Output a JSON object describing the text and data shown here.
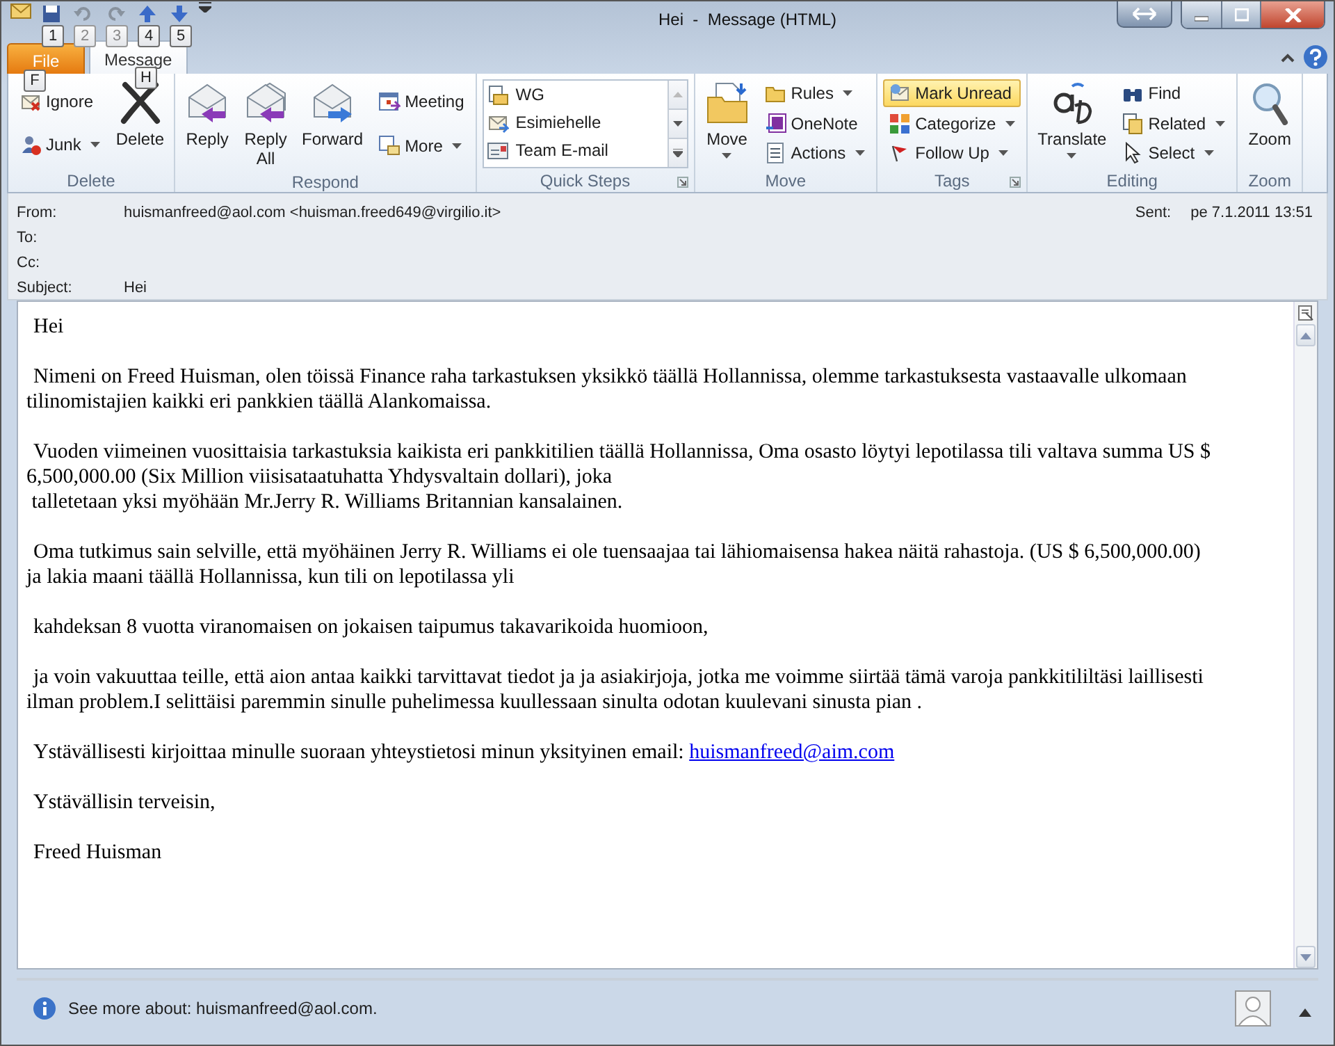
{
  "window": {
    "title": "Hei  -  Message (HTML)"
  },
  "quick_access": [
    {
      "key_tip": "1",
      "disabled": false
    },
    {
      "key_tip": "2",
      "disabled": true
    },
    {
      "key_tip": "3",
      "disabled": true
    },
    {
      "key_tip": "4",
      "disabled": false
    },
    {
      "key_tip": "5",
      "disabled": false
    }
  ],
  "tabs": [
    {
      "label": "File",
      "kind": "file",
      "key_tip": "F",
      "selected": false
    },
    {
      "label": "Message",
      "kind": "tab",
      "key_tip": "H",
      "selected": true
    }
  ],
  "ribbon": {
    "groups": [
      {
        "label": "Delete",
        "columns": [
          {
            "kind": "stack",
            "items": [
              {
                "label": "Ignore",
                "dropdown": false
              },
              {
                "label": "Junk",
                "dropdown": true
              }
            ]
          },
          {
            "kind": "large",
            "label": "Delete",
            "dropdown": false
          }
        ]
      },
      {
        "label": "Respond",
        "columns": [
          {
            "kind": "large",
            "label": "Reply",
            "dropdown": false
          },
          {
            "kind": "large",
            "label": "Reply All",
            "dropdown": false
          },
          {
            "kind": "large",
            "label": "Forward",
            "dropdown": false
          },
          {
            "kind": "stack",
            "items": [
              {
                "label": "Meeting",
                "dropdown": false
              },
              {
                "label": "More",
                "dropdown": true
              }
            ]
          }
        ]
      },
      {
        "label": "Quick Steps",
        "launcher": true,
        "columns": [
          {
            "kind": "gallery",
            "items": [
              {
                "label": "WG"
              },
              {
                "label": "Esimiehelle"
              },
              {
                "label": "Team E-mail"
              }
            ]
          }
        ]
      },
      {
        "label": "Move",
        "columns": [
          {
            "kind": "large",
            "label": "Move",
            "dropdown": true
          },
          {
            "kind": "stack",
            "items": [
              {
                "label": "Rules",
                "dropdown": true
              },
              {
                "label": "OneNote",
                "dropdown": false
              },
              {
                "label": "Actions",
                "dropdown": true
              }
            ]
          }
        ]
      },
      {
        "label": "Tags",
        "launcher": true,
        "columns": [
          {
            "kind": "stack",
            "items": [
              {
                "label": "Mark Unread",
                "dropdown": false,
                "highlighted": true
              },
              {
                "label": "Categorize",
                "dropdown": true,
                "highlighted": false
              },
              {
                "label": "Follow Up",
                "dropdown": true,
                "highlighted": false
              }
            ]
          }
        ]
      },
      {
        "label": "Editing",
        "columns": [
          {
            "kind": "large",
            "label": "Translate",
            "dropdown": true
          },
          {
            "kind": "stack",
            "items": [
              {
                "label": "Find",
                "dropdown": false
              },
              {
                "label": "Related",
                "dropdown": true
              },
              {
                "label": "Select",
                "dropdown": true
              }
            ]
          }
        ]
      },
      {
        "label": "Zoom",
        "columns": [
          {
            "kind": "large",
            "label": "Zoom",
            "dropdown": false
          }
        ]
      }
    ]
  },
  "header": {
    "fields": [
      {
        "label": "From:",
        "value": "huismanfreed@aol.com <huisman.freed649@virgilio.it>"
      },
      {
        "label": "To:"
      },
      {
        "label": "Cc:"
      },
      {
        "label": "Subject:",
        "value": "Hei"
      }
    ],
    "sent": {
      "label": "Sent:",
      "value": "pe 7.1.2011 13:51"
    }
  },
  "message": {
    "paragraphs": [
      {
        "text": "Hei"
      },
      {
        "text": "Nimeni on Freed Huisman, olen töissä Finance raha tarkastuksen yksikkö täällä Hollannissa, olemme tarkastuksesta vastaavalle ulkomaan\ntilinomistajien kaikki eri pankkien täällä Alankomaissa."
      },
      {
        "text": "Vuoden viimeinen vuosittaisia tarkastuksia kaikista eri pankkitilien täällä Hollannissa, Oma osasto löytyi lepotilassa tili valtava summa US $\n6,500,000.00 (Six Million viisisataatuhatta Yhdysvaltain dollari), joka\n talletetaan yksi myöhään Mr.Jerry R. Williams Britannian kansalainen."
      },
      {
        "text": "Oma tutkimus sain selville, että myöhäinen Jerry R. Williams ei ole tuensaajaa tai lähiomaisensa hakea näitä rahastoja. (US $ 6,500,000.00)\nja lakia maani täällä Hollannissa, kun tili on lepotilassa yli"
      },
      {
        "text": "kahdeksan 8 vuotta viranomaisen on jokaisen taipumus takavarikoida huomioon,"
      },
      {
        "text": "ja voin vakuuttaa teille, että aion antaa kaikki tarvittavat tiedot ja ja asiakirjoja, jotka me voimme siirtää tämä varoja pankkitililtäsi laillisesti\nilman problem.I selittäisi paremmin sinulle puhelimessa kuullessaan sinulta odotan kuulevani sinusta pian ."
      },
      {
        "text": "Ystävällisesti kirjoittaa minulle suoraan yhteystietosi minun yksityinen email:",
        "link": "huismanfreed@aim.com"
      },
      {
        "text": "Ystävällisin terveisin,"
      },
      {
        "text": "Freed Huisman"
      }
    ]
  },
  "people_pane": {
    "text": "See more about: huismanfreed@aol.com."
  }
}
